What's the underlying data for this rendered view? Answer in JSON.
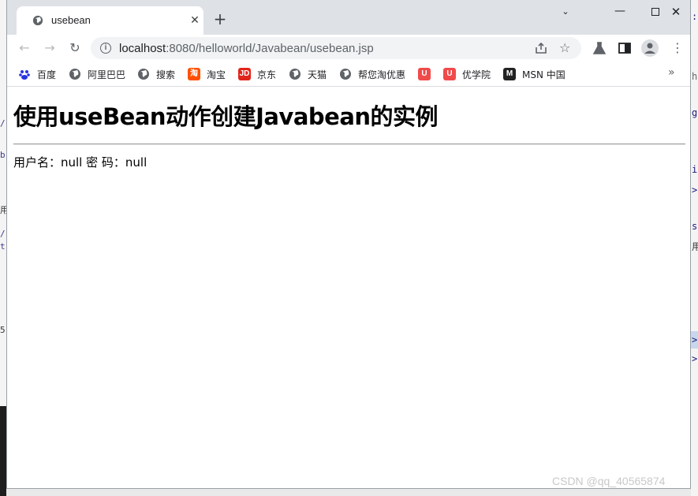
{
  "browser": {
    "tab_title": "usebean",
    "new_tab_symbol": "+",
    "close_symbol": "✕",
    "url_host": "localhost",
    "url_path": ":8080/helloworld/Javabean/usebean.jsp"
  },
  "bookmarks": [
    {
      "label": "百度",
      "icon": "baidu-icon",
      "color": "#2932e1"
    },
    {
      "label": "阿里巴巴",
      "icon": "globe-icon",
      "color": "#5f6368"
    },
    {
      "label": "搜索",
      "icon": "globe-icon",
      "color": "#5f6368"
    },
    {
      "label": "淘宝",
      "icon": "taobao-icon",
      "color": "#ff5000"
    },
    {
      "label": "京东",
      "icon": "jd-icon",
      "color": "#e1251b"
    },
    {
      "label": "天猫",
      "icon": "globe-icon",
      "color": "#5f6368"
    },
    {
      "label": "帮您淘优惠",
      "icon": "globe-icon",
      "color": "#5f6368"
    },
    {
      "label": "",
      "icon": "coupon-icon",
      "color": "#f04a4a"
    },
    {
      "label": "优学院",
      "icon": "coupon-icon",
      "color": "#f04a4a"
    },
    {
      "label": "MSN 中国",
      "icon": "msn-icon",
      "color": "#222222"
    }
  ],
  "page": {
    "heading": "使用useBean动作创建Javabean的实例",
    "info_line": "用户名：null 密 码：null"
  },
  "watermark": "CSDN @qq_40565874",
  "colors": {
    "tab_strip": "#dee1e6",
    "omnibox": "#f1f3f4"
  }
}
